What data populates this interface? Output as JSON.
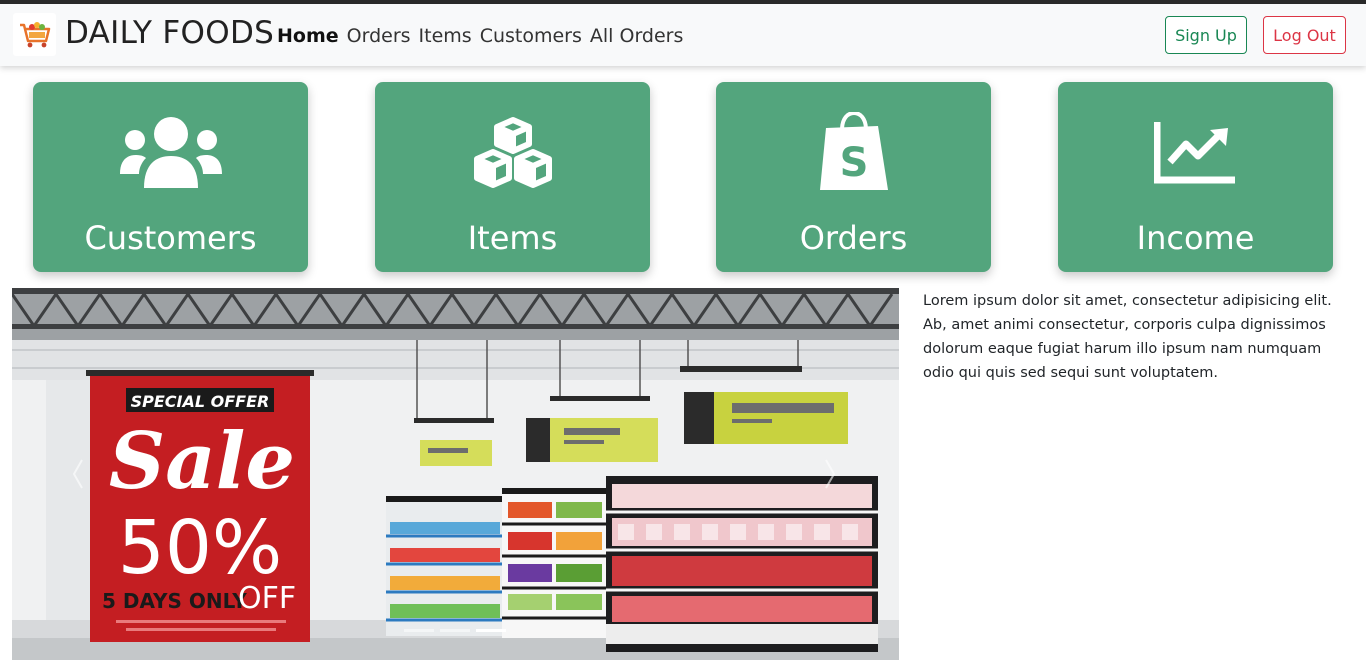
{
  "app": {
    "brand": "DAILY FOODS"
  },
  "nav": {
    "links": [
      {
        "label": "Home",
        "active": true
      },
      {
        "label": "Orders"
      },
      {
        "label": "Items"
      },
      {
        "label": "Customers"
      },
      {
        "label": "All Orders"
      }
    ],
    "signup_label": "Sign Up",
    "logout_label": "Log Out"
  },
  "cards": [
    {
      "label": "Customers",
      "icon": "users-icon"
    },
    {
      "label": "Items",
      "icon": "boxes-icon"
    },
    {
      "label": "Orders",
      "icon": "shopify-bag-icon"
    },
    {
      "label": "Income",
      "icon": "chart-line-icon"
    }
  ],
  "banner": {
    "special_offer": "SPECIAL OFFER",
    "sale": "Sale",
    "percent": "50%",
    "days_only": "5 DAYS ONLY",
    "off": "OFF"
  },
  "description": "Lorem ipsum dolor sit amet, consectetur adipisicing elit. Ab, amet animi consectetur, corporis culpa dignissimos dolorum eaque fugiat harum illo ipsum nam numquam odio qui quis sed sequi sunt voluptatem.",
  "colors": {
    "card_green": "#53a57d",
    "signup_green": "#198754",
    "logout_red": "#dc3545",
    "sale_red": "#c41e22"
  }
}
